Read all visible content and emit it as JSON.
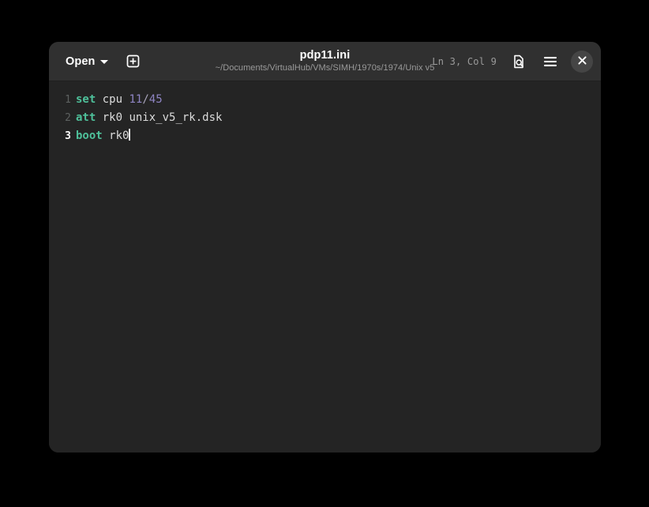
{
  "window": {
    "title": "pdp11.ini",
    "subtitle": "~/Documents/VirtualHub/VMs/SIMH/1970s/1974/Unix v5",
    "background_color": "#242424",
    "headerbar_color": "#303030"
  },
  "headerbar": {
    "open_label": "Open",
    "open_icon": "chevron-down-icon",
    "new_document_icon": "new-document-icon",
    "cursor_position": "Ln 3, Col 9",
    "find_icon": "find-in-document-icon",
    "menu_icon": "hamburger-menu-icon",
    "close_icon": "close-icon"
  },
  "editor": {
    "current_line": 3,
    "cursor_line": 3,
    "cursor_column": 9,
    "accent_keyword_color": "#4ec09a",
    "number_color": "#8f85c4",
    "text_color": "#dcdcdc",
    "gutter_color": "#5d6160",
    "lines": [
      {
        "number": "1",
        "tokens": [
          {
            "text": "set",
            "type": "keyword"
          },
          {
            "text": " ",
            "type": "plain"
          },
          {
            "text": "cpu",
            "type": "plain"
          },
          {
            "text": " ",
            "type": "plain"
          },
          {
            "text": "11",
            "type": "number"
          },
          {
            "text": "/",
            "type": "punct"
          },
          {
            "text": "45",
            "type": "number"
          }
        ]
      },
      {
        "number": "2",
        "tokens": [
          {
            "text": "att",
            "type": "keyword"
          },
          {
            "text": " ",
            "type": "plain"
          },
          {
            "text": "rk0 unix_v5_rk.dsk",
            "type": "plain"
          }
        ]
      },
      {
        "number": "3",
        "tokens": [
          {
            "text": "boot",
            "type": "keyword"
          },
          {
            "text": " ",
            "type": "plain"
          },
          {
            "text": "rk0",
            "type": "plain"
          }
        ]
      }
    ]
  }
}
